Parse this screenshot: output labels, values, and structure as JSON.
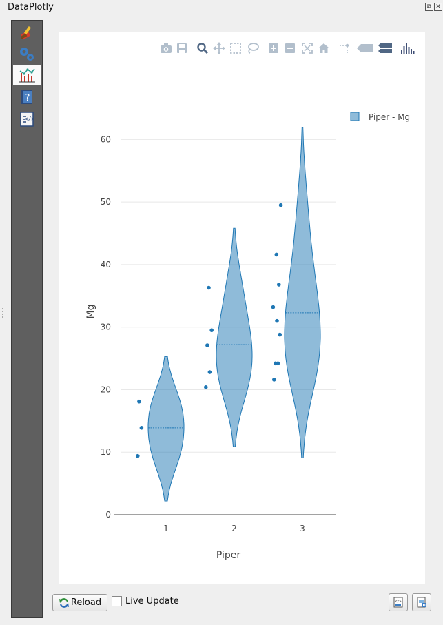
{
  "window": {
    "title": "DataPlotly"
  },
  "sidebar": {
    "items": [
      {
        "name": "properties",
        "icon": "brush-icon"
      },
      {
        "name": "settings",
        "icon": "gears-icon"
      },
      {
        "name": "plot",
        "icon": "chart-icon",
        "active": true
      },
      {
        "name": "help",
        "icon": "help-book-icon"
      },
      {
        "name": "code",
        "icon": "code-icon"
      }
    ]
  },
  "modebar": {
    "buttons": [
      "camera-icon",
      "save-icon",
      "zoom-icon",
      "pan-icon",
      "box-select-icon",
      "lasso-icon",
      "zoom-in-icon",
      "zoom-out-icon",
      "autoscale-icon",
      "home-icon",
      "spike-icon",
      "hover-closest-icon",
      "hover-compare-icon",
      "plotly-logo-icon"
    ]
  },
  "chart_data": {
    "type": "violin",
    "xlabel": "Piper",
    "ylabel": "Mg",
    "ylim": [
      0,
      65
    ],
    "yticks": [
      0,
      10,
      20,
      30,
      40,
      50,
      60
    ],
    "categories": [
      "1",
      "2",
      "3"
    ],
    "color": "#1f77b4",
    "series": [
      {
        "name": "Piper - Mg",
        "groups": [
          {
            "category": "1",
            "points": [
              9.4,
              13.9,
              18.1
            ],
            "median": 13.9,
            "range": [
              2.2,
              25.3
            ]
          },
          {
            "category": "2",
            "points": [
              20.4,
              22.8,
              27.1,
              29.5,
              36.3
            ],
            "median": 27.2,
            "range": [
              10.9,
              45.8
            ]
          },
          {
            "category": "3",
            "points": [
              21.6,
              24.2,
              24.2,
              28.8,
              31.0,
              33.2,
              36.8,
              41.6,
              49.5
            ],
            "median": 32.3,
            "range": [
              9.1,
              61.9
            ]
          }
        ]
      }
    ],
    "legend": {
      "placement": "top-right"
    },
    "grid": true
  },
  "controls": {
    "reload_label": "Reload",
    "live_update_label": "Live Update",
    "live_update_checked": false
  }
}
